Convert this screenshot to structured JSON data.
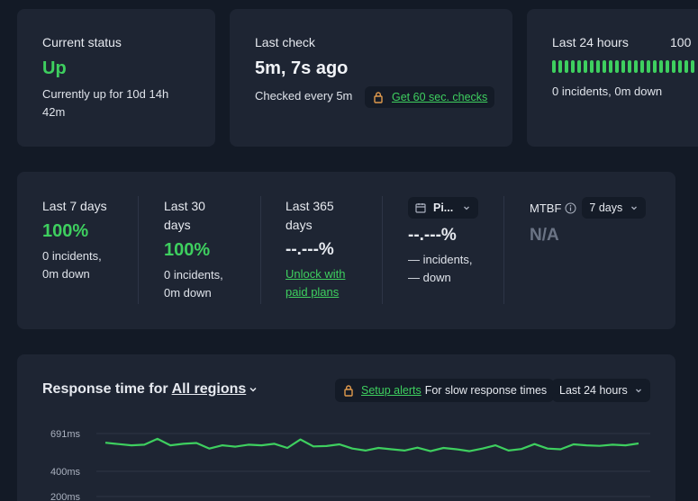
{
  "status_card": {
    "label": "Current status",
    "value": "Up",
    "duration_line1": "Currently up for 10d 14h",
    "duration_line2": "42m"
  },
  "last_check_card": {
    "label": "Last check",
    "value": "5m, 7s ago",
    "interval": "Checked every 5m",
    "upgrade_link": "Get 60 sec. checks"
  },
  "last24_card": {
    "label": "Last 24 hours",
    "percent": "100",
    "summary": "0 incidents, 0m down"
  },
  "uptime": {
    "last7": {
      "label": "Last 7 days",
      "value": "100%",
      "line1": "0 incidents,",
      "line2": "0m down"
    },
    "last30": {
      "label_line1": "Last 30",
      "label_line2": "days",
      "value": "100%",
      "line1": "0 incidents,",
      "line2": "0m down"
    },
    "last365": {
      "label_line1": "Last 365",
      "label_line2": "days",
      "value": "--.---%",
      "link_line1": "Unlock with",
      "link_line2": "paid plans"
    },
    "custom": {
      "picker_label": "Pi...",
      "value": "--.---%",
      "line1": "— incidents,",
      "line2": "— down"
    },
    "mtbf": {
      "label": "MTBF",
      "select": "7 days",
      "value": "N/A"
    }
  },
  "response": {
    "title_prefix": "Response time for",
    "region_link": "All regions",
    "alerts_link": "Setup alerts",
    "alerts_text": "For slow response times",
    "range_select": "Last 24 hours"
  },
  "colors": {
    "accent": "#3ecf5f",
    "card": "#1e2533",
    "background": "#131a26",
    "lock": "#e09a4d"
  },
  "chart_data": {
    "type": "line",
    "title": "",
    "xlabel": "",
    "ylabel": "",
    "y_ticks": [
      "691ms",
      "400ms",
      "200ms"
    ],
    "ylim": [
      200,
      691
    ],
    "grid": true,
    "series": [
      {
        "values": [
          620,
          610,
          600,
          605,
          650,
          600,
          612,
          618,
          575,
          600,
          590,
          605,
          600,
          612,
          580,
          645,
          592,
          595,
          608,
          575,
          560,
          580,
          570,
          560,
          582,
          555,
          580,
          570,
          555,
          575,
          600,
          560,
          572,
          610,
          575,
          570,
          608,
          600,
          596,
          605,
          600,
          615
        ]
      }
    ]
  }
}
